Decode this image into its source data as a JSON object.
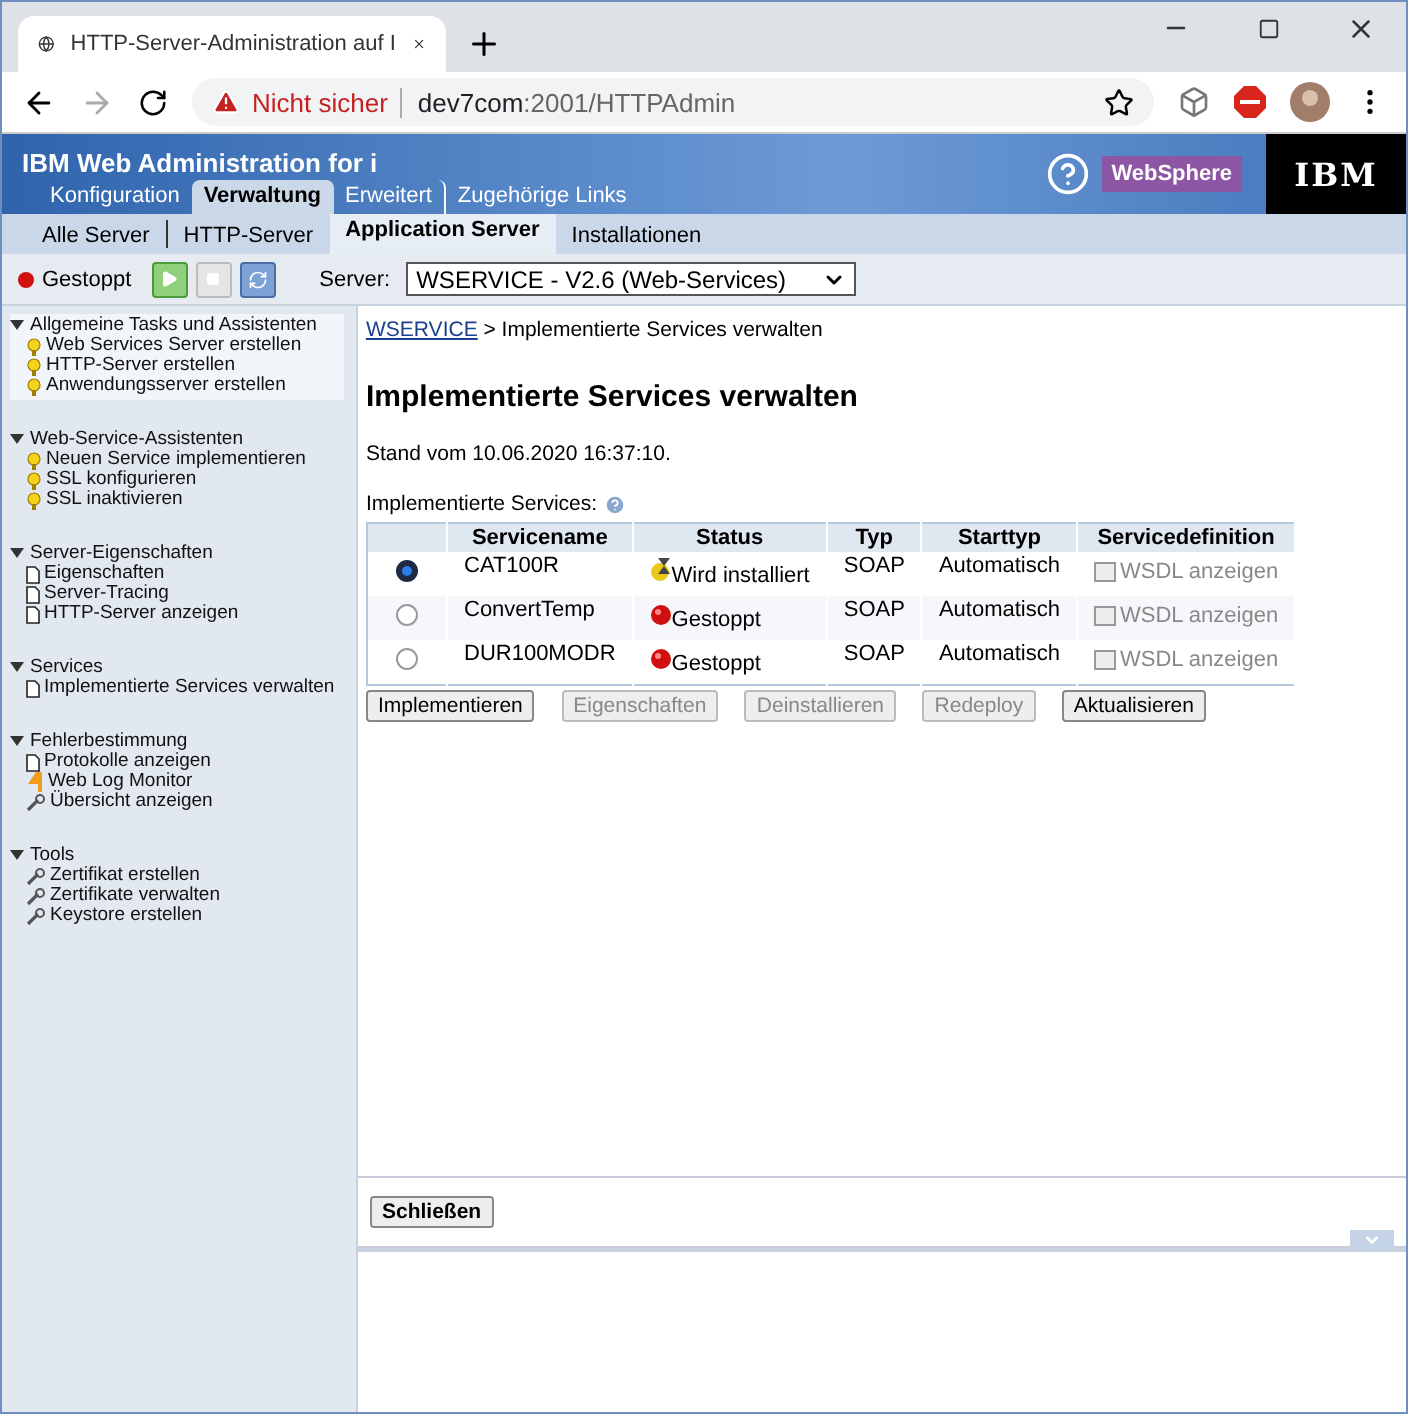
{
  "browser": {
    "tab_title": "HTTP-Server-Administration auf I",
    "security": "Nicht sicher",
    "url_host": "dev7com",
    "url_rest": ":2001/HTTPAdmin"
  },
  "header": {
    "title": "IBM Web Administration for i",
    "brand": "WebSphere",
    "logo": "IBM",
    "tabs": [
      {
        "label": "Konfiguration",
        "selected": false
      },
      {
        "label": "Verwaltung",
        "selected": true
      },
      {
        "label": "Erweitert",
        "selected": false
      },
      {
        "label": "Zugehörige Links",
        "selected": false
      }
    ],
    "subtabs": [
      {
        "label": "Alle Server",
        "selected": false
      },
      {
        "label": "HTTP-Server",
        "selected": false
      },
      {
        "label": "Application Server",
        "selected": true
      },
      {
        "label": "Installationen",
        "selected": false
      }
    ]
  },
  "toolbar": {
    "status": "Gestoppt",
    "server_label": "Server:",
    "server": "WSERVICE - V2.6 (Web-Services)"
  },
  "sidebar": [
    {
      "title": "Allgemeine Tasks und Assistenten",
      "expanded": true,
      "selected": true,
      "items": [
        {
          "label": "Web Services Server erstellen",
          "kind": "wizard"
        },
        {
          "label": "HTTP-Server erstellen",
          "kind": "wizard"
        },
        {
          "label": "Anwendungsserver erstellen",
          "kind": "wizard"
        }
      ]
    },
    {
      "title": "Web-Service-Assistenten",
      "expanded": true,
      "selected": false,
      "items": [
        {
          "label": "Neuen Service implementieren",
          "kind": "wizard"
        },
        {
          "label": "SSL konfigurieren",
          "kind": "wizard"
        },
        {
          "label": "SSL inaktivieren",
          "kind": "wizard"
        }
      ]
    },
    {
      "title": "Server-Eigenschaften",
      "expanded": true,
      "selected": false,
      "items": [
        {
          "label": "Eigenschaften",
          "kind": "page"
        },
        {
          "label": "Server-Tracing",
          "kind": "page"
        },
        {
          "label": "HTTP-Server anzeigen",
          "kind": "page"
        }
      ]
    },
    {
      "title": "Services",
      "expanded": true,
      "selected": false,
      "items": [
        {
          "label": "Implementierte Services verwalten",
          "kind": "page"
        }
      ]
    },
    {
      "title": "Fehlerbestimmung",
      "expanded": true,
      "selected": false,
      "items": [
        {
          "label": "Protokolle anzeigen",
          "kind": "page"
        },
        {
          "label": "Web Log Monitor",
          "kind": "monitor"
        },
        {
          "label": "Übersicht anzeigen",
          "kind": "tool"
        }
      ]
    },
    {
      "title": "Tools",
      "expanded": true,
      "selected": false,
      "items": [
        {
          "label": "Zertifikat erstellen",
          "kind": "tool"
        },
        {
          "label": "Zertifikate verwalten",
          "kind": "tool"
        },
        {
          "label": "Keystore erstellen",
          "kind": "tool"
        }
      ]
    }
  ],
  "main": {
    "breadcrumb_link": "WSERVICE",
    "breadcrumb_rest": "> Implementierte Services verwalten",
    "heading": "Implementierte Services verwalten",
    "timestamp": "Stand vom 10.06.2020 16:37:10.",
    "table_label": "Implementierte Services:",
    "columns": [
      "Servicename",
      "Status",
      "Typ",
      "Starttyp",
      "Servicedefinition"
    ],
    "rows": [
      {
        "selected": true,
        "name": "CAT100R",
        "status": "Wird installiert",
        "kind": "installing",
        "type": "SOAP",
        "start": "Automatisch",
        "definition": "WSDL anzeigen"
      },
      {
        "selected": false,
        "name": "ConvertTemp",
        "status": "Gestoppt",
        "kind": "stopped",
        "type": "SOAP",
        "start": "Automatisch",
        "definition": "WSDL anzeigen"
      },
      {
        "selected": false,
        "name": "DUR100MODR",
        "status": "Gestoppt",
        "kind": "stopped",
        "type": "SOAP",
        "start": "Automatisch",
        "definition": "WSDL anzeigen"
      }
    ],
    "buttons": [
      {
        "label": "Implementieren",
        "disabled": false
      },
      {
        "label": "Eigenschaften",
        "disabled": true
      },
      {
        "label": "Deinstallieren",
        "disabled": true
      },
      {
        "label": "Redeploy",
        "disabled": true
      },
      {
        "label": "Aktualisieren",
        "disabled": false
      }
    ],
    "close_button": "Schließen"
  }
}
